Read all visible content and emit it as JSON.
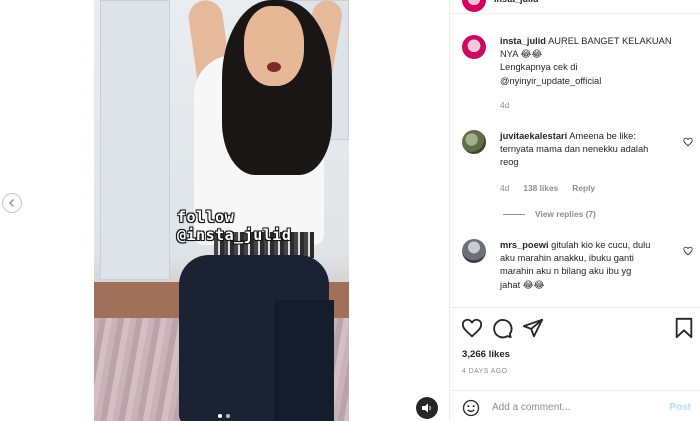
{
  "post": {
    "author": "insta_julid",
    "watermark": "follow @insta_julid",
    "caption": {
      "username": "insta_julid",
      "text_line1": "AUREL BANGET KELAKUAN",
      "text_line2": "NYA 😂😂",
      "text_line3": "Lengkapnya cek di",
      "text_line4": "@nyinyir_update_official",
      "age": "4d"
    },
    "likes": "3,266 likes",
    "posted_ago": "4 DAYS AGO"
  },
  "comments": [
    {
      "username": "juvitaekalestari",
      "line1": "Ameena be like:",
      "line2": "ternyata mama dan nenekku adalah",
      "line3": "reog",
      "age": "4d",
      "likes": "138 likes",
      "reply_label": "Reply",
      "view_replies": "View replies (7)"
    },
    {
      "username": "mrs_poewi",
      "line1": "gitulah kio ke cucu, dulu",
      "line2": "aku marahin anakku, ibuku ganti",
      "line3": "marahin aku n bilang aku ibu yg",
      "line4": "jahat 😂😂"
    }
  ],
  "composer": {
    "placeholder": "Add a comment...",
    "post_label": "Post"
  },
  "icons": {
    "like": "heart-icon",
    "comment": "comment-icon",
    "share": "share-icon",
    "save": "bookmark-icon",
    "emoji": "smiley-icon",
    "audio": "speaker-icon",
    "prev": "chevron-left-icon"
  },
  "colors": {
    "post_button": "#b2dffc",
    "muted_text": "#8e8e8e",
    "primary_text": "#262626"
  }
}
